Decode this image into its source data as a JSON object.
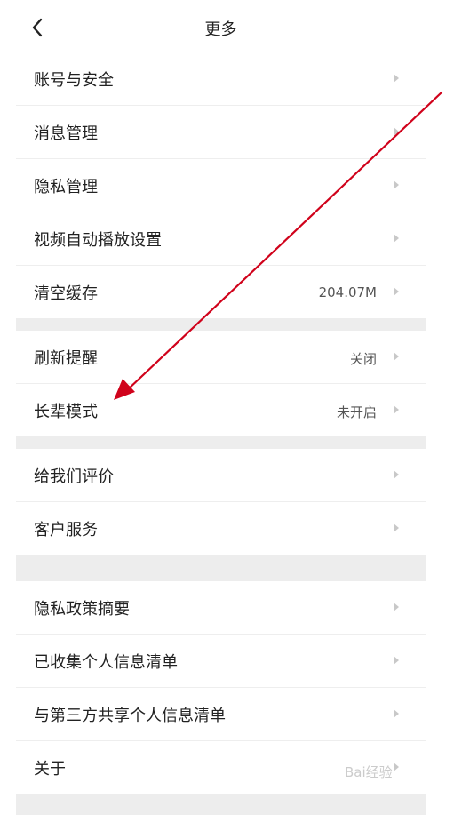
{
  "header": {
    "title": "更多"
  },
  "groups": [
    {
      "items": [
        {
          "label": "账号与安全",
          "value": ""
        },
        {
          "label": "消息管理",
          "value": ""
        },
        {
          "label": "隐私管理",
          "value": ""
        },
        {
          "label": "视频自动播放设置",
          "value": ""
        },
        {
          "label": "清空缓存",
          "value": "204.07M"
        }
      ]
    },
    {
      "items": [
        {
          "label": "刷新提醒",
          "value": "关闭"
        },
        {
          "label": "长辈模式",
          "value": "未开启"
        }
      ]
    },
    {
      "items": [
        {
          "label": "给我们评价",
          "value": ""
        },
        {
          "label": "客户服务",
          "value": ""
        }
      ]
    },
    {
      "items": [
        {
          "label": "隐私政策摘要",
          "value": ""
        },
        {
          "label": "已收集个人信息清单",
          "value": ""
        },
        {
          "label": "与第三方共享个人信息清单",
          "value": ""
        },
        {
          "label": "关于",
          "value": ""
        }
      ]
    }
  ],
  "icons": {
    "back": "chevron-left-icon",
    "row": "chevron-right-icon"
  },
  "colors": {
    "separator_band": "#ededed",
    "annotation_arrow": "#d0021b",
    "chevron": "#c8c8c8"
  },
  "watermark": "Bai经验"
}
